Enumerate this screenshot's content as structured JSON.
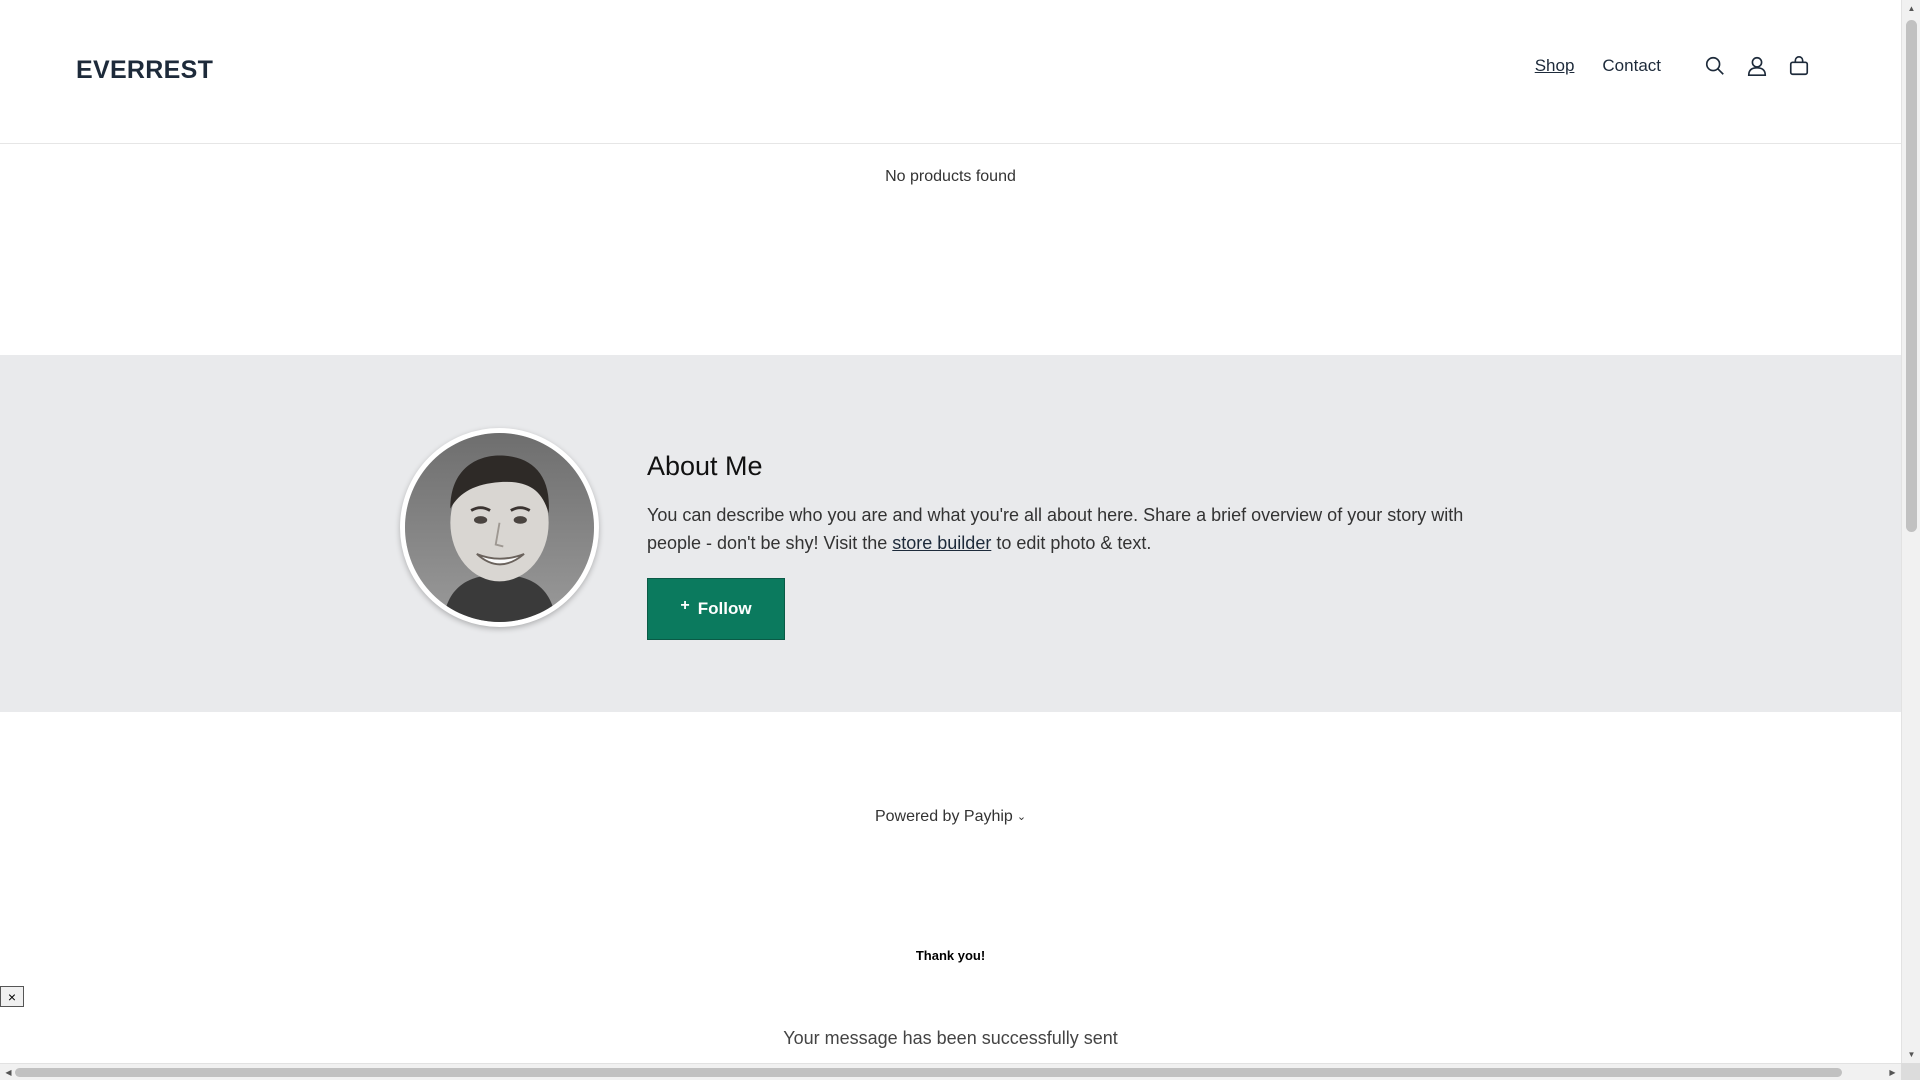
{
  "header": {
    "logo": "EVERREST",
    "nav": [
      {
        "label": "Shop",
        "active": true
      },
      {
        "label": "Contact",
        "active": false
      }
    ],
    "icons": [
      "search-icon",
      "account-icon",
      "cart-icon"
    ]
  },
  "main": {
    "empty_message": "No products found"
  },
  "about": {
    "title": "About Me",
    "text_before": "You can describe who you are and what you're all about here. Share a brief overview of your story with people - don't be shy! Visit the ",
    "link_label": "store builder",
    "text_after": " to edit photo & text.",
    "follow_label": "Follow",
    "accent_color": "#0b7a5e"
  },
  "footer": {
    "powered_by": "Powered by Payhip"
  },
  "notification": {
    "title": "Thank you!",
    "close_label": "×",
    "message": "Your message has been successfully sent"
  }
}
